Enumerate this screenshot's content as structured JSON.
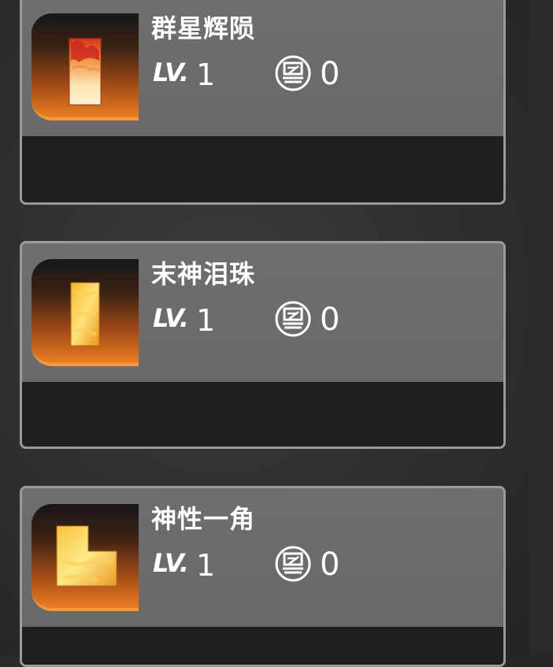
{
  "items": [
    {
      "name": "群星辉陨",
      "level_label": "LV.",
      "level": "1",
      "count": "0",
      "icon": "fire-shard-tall-icon"
    },
    {
      "name": "末神泪珠",
      "level_label": "LV.",
      "level": "1",
      "count": "0",
      "icon": "fire-shard-bar-icon"
    },
    {
      "name": "神性一角",
      "level_label": "LV.",
      "level": "1",
      "count": "0",
      "icon": "fire-shard-l-icon"
    }
  ],
  "colors": {
    "card_bg": "#6b6b6b",
    "card_border": "#9a9a9a",
    "footer_bg": "#1f1f1f",
    "thumb_accent": "#ea7e24"
  }
}
